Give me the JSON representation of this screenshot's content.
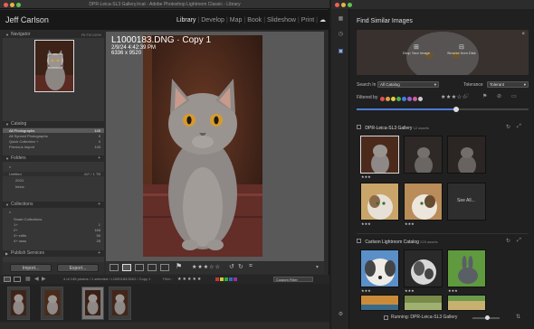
{
  "lightroom": {
    "window_title": "DPR-Leica-SL3 Gallery.lrcat - Adobe Photoshop Lightroom Classic - Library",
    "identity_plate": "Jeff Carlson",
    "modules": [
      "Library",
      "Develop",
      "Map",
      "Book",
      "Slideshow",
      "Print"
    ],
    "active_module": "Library",
    "navigator": {
      "title": "Navigator",
      "zoom_options": [
        "Fit",
        "Fill",
        "100%",
        "100%"
      ]
    },
    "catalog": {
      "title": "Catalog",
      "items": [
        {
          "label": "All Photographs",
          "count": "145"
        },
        {
          "label": "All Synced Photographs",
          "count": "0"
        },
        {
          "label": "Quick Collection +",
          "count": "0"
        },
        {
          "label": "Previous Import",
          "count": "145"
        }
      ]
    },
    "folders": {
      "title": "Folders",
      "volume": "Untitled",
      "volume_info": "417 / 1 TB",
      "items": [
        "2024",
        "Inbox"
      ]
    },
    "collections": {
      "title": "Collections",
      "items": [
        {
          "label": "Smart Collections",
          "count": ""
        },
        {
          "label": "1+",
          "count": "1"
        },
        {
          "label": "2+",
          "count": "168"
        },
        {
          "label": "3+ edits",
          "count": "56"
        },
        {
          "label": "4+ raws",
          "count": "28"
        }
      ]
    },
    "publish_services": {
      "title": "Publish Services"
    },
    "import_label": "Import...",
    "export_label": "Export...",
    "photo_overlay": {
      "title": "L1000183.DNG · Copy 1",
      "date": "2/9/24 4:42:39 PM",
      "dims": "6336 x 9520"
    },
    "filmstrip": {
      "status": "4 of 145 photos / 1 selected / L1000183.DNG / Copy 1",
      "filter_label": "Filter :",
      "custom_filter": "Custom Filter"
    }
  },
  "find_similar": {
    "title": "Find Similar Images",
    "drop_label": "Drop Your Image",
    "browse_label": "Browse from Disk",
    "search_in_label": "Search In",
    "search_in_value": "All Catalog",
    "tolerance_label": "Tolerance",
    "tolerance_value": "Tolerant",
    "filtered_by_label": "Filtered by",
    "filter_colors": [
      "#e05050",
      "#e0a040",
      "#e0d040",
      "#50b050",
      "#4080e0",
      "#a060d0",
      "#d060a0",
      "#cccccc"
    ],
    "galleries": [
      {
        "name": "DPR-Leica-SL3 Gallery",
        "count": "12 assets"
      },
      {
        "name": "Carlson Lightroom Catalog",
        "count": "229 assets"
      }
    ],
    "see_all_label": "See All...",
    "running_label": "Running: DPR-Leica-SL3 Gallery"
  }
}
